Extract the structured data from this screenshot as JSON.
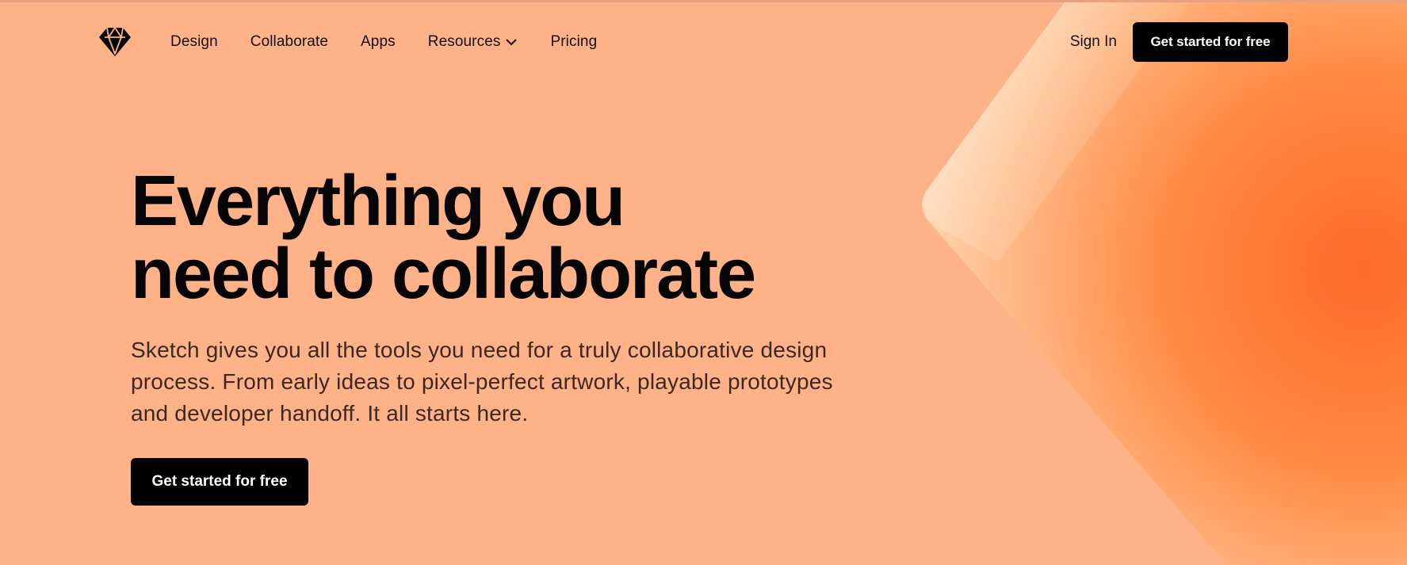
{
  "colors": {
    "background": "#ffb188",
    "accent": "#ff6a2b",
    "button": "#000000",
    "button_text": "#ffffff"
  },
  "nav": {
    "logo_icon": "sketch-diamond-icon",
    "links": [
      {
        "label": "Design"
      },
      {
        "label": "Collaborate"
      },
      {
        "label": "Apps"
      },
      {
        "label": "Resources",
        "icon": "chevron-down-icon"
      },
      {
        "label": "Pricing"
      }
    ],
    "sign_in": "Sign In",
    "cta": "Get started for free"
  },
  "hero": {
    "headline_line1": "Everything you",
    "headline_line2": "need to collaborate",
    "subtext": "Sketch gives you all the tools you need for a truly collaborative design process. From early ideas to pixel-perfect artwork, playable prototypes and developer handoff. It all starts here.",
    "cta": "Get started for free"
  }
}
